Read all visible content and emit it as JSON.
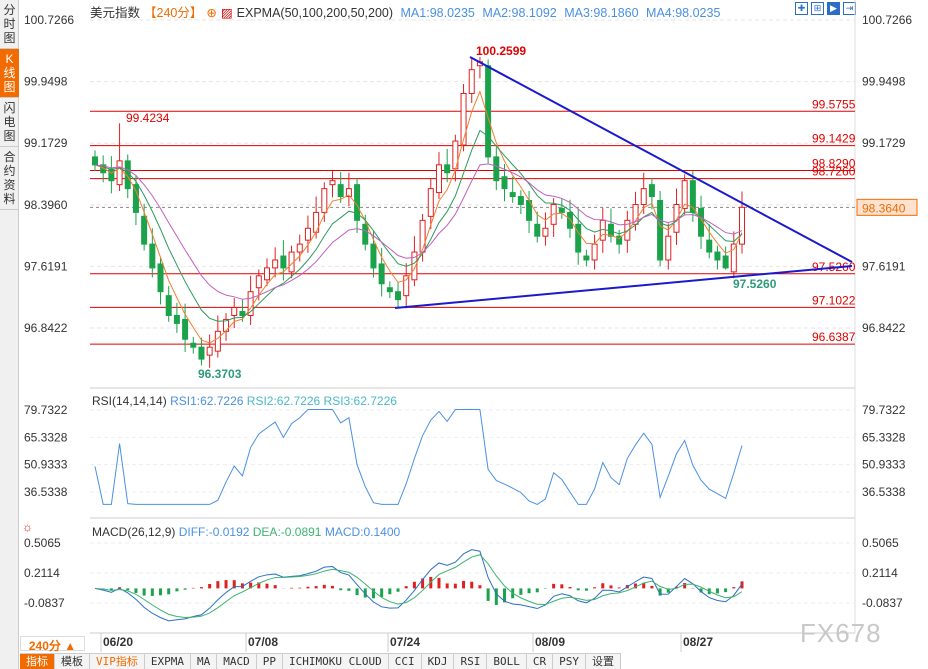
{
  "sidebar": {
    "items": [
      {
        "label": "分时图",
        "active": false
      },
      {
        "label": "K线图",
        "active": true
      },
      {
        "label": "闪电图",
        "active": false
      },
      {
        "label": "合约资料",
        "active": false
      }
    ]
  },
  "header": {
    "title": "美元指数",
    "period": "【240分】",
    "indicator": "EXPMA(50,100,200,50,200)",
    "ma": [
      {
        "label": "MA1:98.0235",
        "color": "#4a90e2"
      },
      {
        "label": "MA2:98.1092",
        "color": "#4a90e2"
      },
      {
        "label": "MA3:98.1860",
        "color": "#4a90e2"
      },
      {
        "label": "MA4:98.0235",
        "color": "#4a90e2"
      }
    ]
  },
  "toolbar_icons": [
    "crosshair-icon",
    "zoom-range-icon",
    "play-icon",
    "move-right-icon"
  ],
  "price_axis": [
    "100.7266",
    "99.9498",
    "99.1729",
    "98.3960",
    "97.6191",
    "96.8422"
  ],
  "current_price": "98.3640",
  "levels": [
    {
      "label": "99.5755",
      "value": 99.5755
    },
    {
      "label": "99.1429",
      "value": 99.1429
    },
    {
      "label": "98.8290",
      "value": 98.829
    },
    {
      "label": "98.7260",
      "value": 98.726
    },
    {
      "label": "97.5260",
      "value": 97.526
    },
    {
      "label": "97.1022",
      "value": 97.1022
    },
    {
      "label": "96.6387",
      "value": 96.6387
    }
  ],
  "annotations": {
    "high1": "99.4234",
    "high2": "100.2599",
    "low": "96.3703",
    "support": "97.5260"
  },
  "rsi": {
    "title": "RSI(14,14,14)",
    "rsi1": "RSI1:62.7226",
    "rsi2": "RSI2:62.7226",
    "rsi3": "RSI3:62.7226",
    "axis": [
      "79.7322",
      "65.3328",
      "50.9333",
      "36.5338"
    ]
  },
  "macd": {
    "title": "MACD(26,12,9)",
    "diff": "DIFF:-0.0192",
    "dea": "DEA:-0.0891",
    "macd": "MACD:0.1400",
    "axis": [
      "0.5065",
      "0.2114",
      "-0.0837"
    ]
  },
  "period_button": "240分 ▲",
  "dates": [
    "06/20",
    "07/08",
    "07/24",
    "08/09",
    "08/27"
  ],
  "tabs": [
    "指标",
    "模板",
    "VIP指标",
    "EXPMA",
    "MA",
    "MACD",
    "PP",
    "ICHIMOKU CLOUD",
    "CCI",
    "KDJ",
    "RSI",
    "BOLL",
    "CR",
    "PSY",
    "设置"
  ],
  "watermark": "FX678",
  "colors": {
    "up": "#e02020",
    "down": "#1aa34a",
    "level": "#e00000",
    "trend": "#1a1acd",
    "accent": "#f26b00"
  },
  "chart_data": {
    "type": "candlestick",
    "closes": [
      98.9,
      98.8,
      98.7,
      98.95,
      98.6,
      98.3,
      97.9,
      97.6,
      97.3,
      97.0,
      96.9,
      96.7,
      96.6,
      96.45,
      96.6,
      96.8,
      96.95,
      97.1,
      97.0,
      97.3,
      97.5,
      97.6,
      97.7,
      97.6,
      97.8,
      97.9,
      98.1,
      98.3,
      98.6,
      98.7,
      98.5,
      98.6,
      98.2,
      97.9,
      97.6,
      97.4,
      97.3,
      97.2,
      97.5,
      97.8,
      98.2,
      98.6,
      98.9,
      98.8,
      99.2,
      99.8,
      100.1,
      100.2,
      99.0,
      98.7,
      98.6,
      98.5,
      98.4,
      98.2,
      98.0,
      98.1,
      98.4,
      98.3,
      98.1,
      97.8,
      97.7,
      97.9,
      98.2,
      98.0,
      97.9,
      98.2,
      98.4,
      98.6,
      98.5,
      97.7,
      98.0,
      98.4,
      98.7,
      98.3,
      98.0,
      97.8,
      97.7,
      97.6,
      97.9,
      98.364
    ],
    "ylim": [
      96.2,
      100.7266
    ]
  }
}
